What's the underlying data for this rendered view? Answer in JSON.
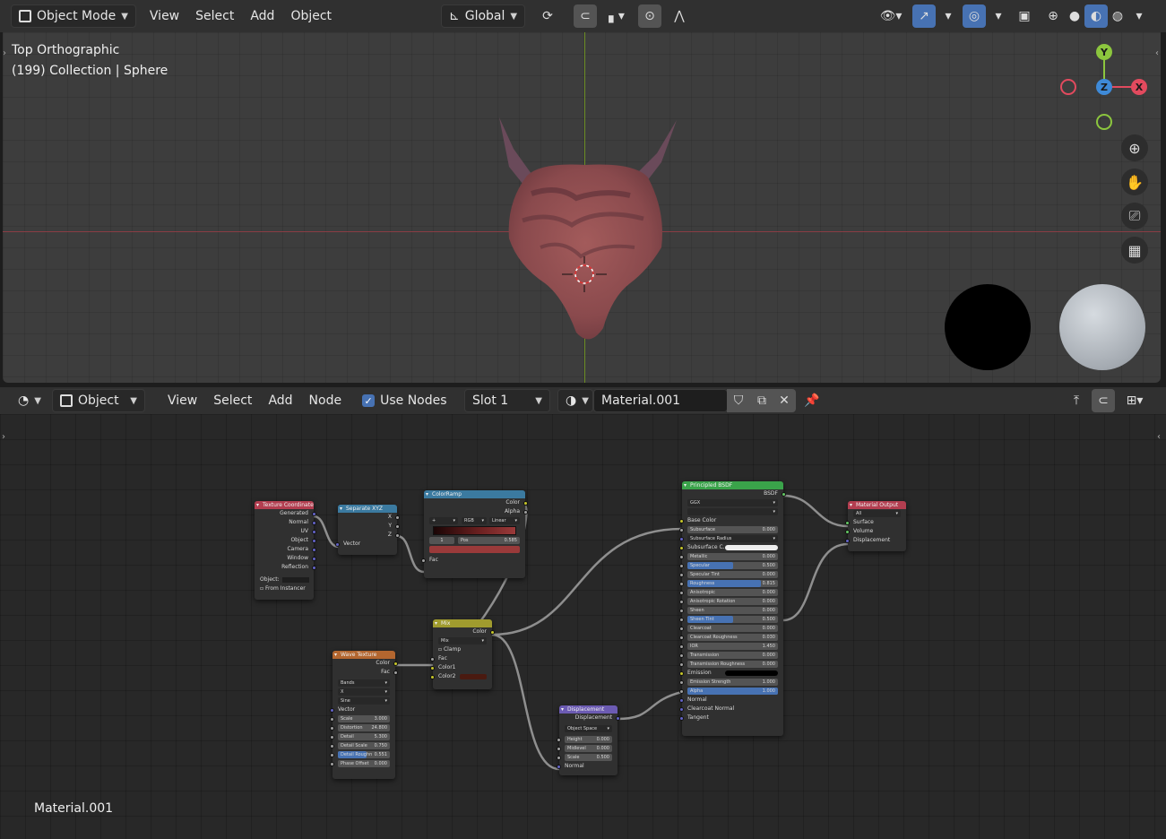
{
  "viewport_header": {
    "mode_label": "Object Mode",
    "menus": [
      "View",
      "Select",
      "Add",
      "Object"
    ],
    "transform_orientation": "Global"
  },
  "viewport": {
    "view_name": "Top Orthographic",
    "collection_info": "(199) Collection | Sphere",
    "gizmo": {
      "y": "Y",
      "z": "Z",
      "x": "X"
    }
  },
  "node_header": {
    "editor_type": "Object",
    "menus": [
      "View",
      "Select",
      "Add",
      "Node"
    ],
    "use_nodes_label": "Use Nodes",
    "slot": "Slot 1",
    "material_name": "Material.001"
  },
  "node_editor": {
    "footer_label": "Material.001",
    "nodes": {
      "texcoord": {
        "title": "Texture Coordinate",
        "outputs": [
          "Generated",
          "Normal",
          "UV",
          "Object",
          "Camera",
          "Window",
          "Reflection"
        ],
        "object_label": "Object:",
        "from_instancer": "From Instancer"
      },
      "separate": {
        "title": "Separate XYZ",
        "outputs": [
          "X",
          "Y",
          "Z"
        ],
        "input": "Vector"
      },
      "colorramp": {
        "title": "ColorRamp",
        "outputs": [
          "Color",
          "Alpha"
        ],
        "mode": "RGB",
        "interp": "Linear",
        "index": "1",
        "pos_label": "Pos",
        "pos_value": "0.585",
        "input": "Fac"
      },
      "mix": {
        "title": "Mix",
        "output": "Color",
        "blend": "Mix",
        "clamp": "Clamp",
        "inputs": [
          "Fac",
          "Color1",
          "Color2"
        ]
      },
      "wave": {
        "title": "Wave Texture",
        "outputs": [
          "Color",
          "Fac"
        ],
        "type": "Bands",
        "axis": "X",
        "profile": "Sine",
        "vector": "Vector",
        "params": [
          {
            "label": "Scale",
            "value": "3.000"
          },
          {
            "label": "Distortion",
            "value": "24.800"
          },
          {
            "label": "Detail",
            "value": "5.300"
          },
          {
            "label": "Detail Scale",
            "value": "0.750"
          },
          {
            "label": "Detail Roughn",
            "value": "0.551"
          },
          {
            "label": "Phase Offset",
            "value": "0.000"
          }
        ]
      },
      "displacement": {
        "title": "Displacement",
        "output": "Displacement",
        "space": "Object Space",
        "params": [
          {
            "label": "Height",
            "value": "0.000"
          },
          {
            "label": "Midlevel",
            "value": "0.000"
          },
          {
            "label": "Scale",
            "value": "0.500"
          }
        ],
        "normal": "Normal"
      },
      "bsdf": {
        "title": "Principled BSDF",
        "output": "BSDF",
        "distribution": "GGX",
        "subsurface_method": "",
        "base_color": "Base Color",
        "subsurface_radius": "Subsurface Radius",
        "subsurface_color": "Subsurface C...",
        "emission": "Emission",
        "params": [
          {
            "label": "Subsurface",
            "value": "0.000"
          },
          {
            "label": "Metallic",
            "value": "0.000"
          },
          {
            "label": "Specular",
            "value": "0.500"
          },
          {
            "label": "Specular Tint",
            "value": "0.000"
          },
          {
            "label": "Roughness",
            "value": "0.815"
          },
          {
            "label": "Anisotropic",
            "value": "0.000"
          },
          {
            "label": "Anisotropic Rotation",
            "value": "0.000"
          },
          {
            "label": "Sheen",
            "value": "0.000"
          },
          {
            "label": "Sheen Tint",
            "value": "0.500"
          },
          {
            "label": "Clearcoat",
            "value": "0.000"
          },
          {
            "label": "Clearcoat Roughness",
            "value": "0.030"
          },
          {
            "label": "IOR",
            "value": "1.450"
          },
          {
            "label": "Transmission",
            "value": "0.000"
          },
          {
            "label": "Transmission Roughness",
            "value": "0.000"
          }
        ],
        "emission_strength": {
          "label": "Emission Strength",
          "value": "1.000"
        },
        "alpha": {
          "label": "Alpha",
          "value": "1.000"
        },
        "vectors": [
          "Normal",
          "Clearcoat Normal",
          "Tangent"
        ]
      },
      "output": {
        "title": "Material Output",
        "target": "All",
        "inputs": [
          "Surface",
          "Volume",
          "Displacement"
        ]
      }
    }
  },
  "colors": {
    "accent": "#4772b3",
    "header": "#303030",
    "viewport_bg": "#3d3d3d"
  }
}
